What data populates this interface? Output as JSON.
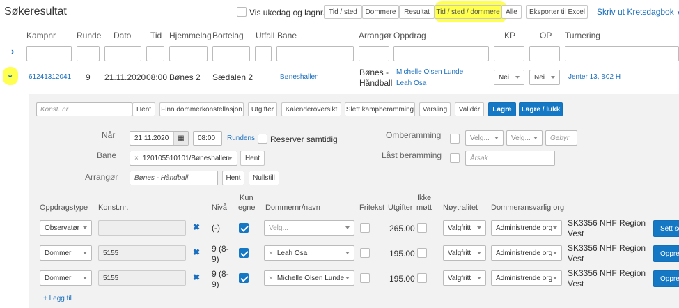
{
  "page_title": "Søkeresultat",
  "show_weekday_label": "Vis ukedag og lagnr.",
  "view_tabs": [
    "Tid / sted",
    "Dommere",
    "Resultat",
    "Tid / sted / dommere",
    "Alle"
  ],
  "export_label": "Eksporter til Excel",
  "print_label": "Skriv ut Kretsdagbok",
  "columns": [
    "Kampnr",
    "Runde",
    "Dato",
    "Tid",
    "Hjemmelag",
    "Bortelag",
    "Utfall",
    "Bane",
    "Arrangør",
    "Oppdrag",
    "KP",
    "OP",
    "Turnering"
  ],
  "match": {
    "kampnr": "61241312041",
    "runde": "9",
    "dato": "21.11.2020",
    "tid": "08:00",
    "hjemmelag": "Bønes 2",
    "bortelag": "Sædalen 2",
    "bane": "Bøneshallen",
    "arrangor_line1": "Bønes -",
    "arrangor_line2": "Håndball",
    "oppdrag1": "Michelle Olsen Lunde",
    "oppdrag2": "Leah Osa",
    "kp": "Nei",
    "op": "Nei",
    "turnering": "Jenter 13, B02 H"
  },
  "toolbar": {
    "konst_placeholder": "Konst. nr",
    "hent": "Hent",
    "finn": "Finn dommerkonstellasjon",
    "utgifter": "Utgifter",
    "kalender": "Kalenderoversikt",
    "slett": "Slett kampberamming",
    "varsling": "Varsling",
    "valider": "Validér",
    "lagre": "Lagre",
    "lagre_lukk": "Lagre / lukk"
  },
  "form": {
    "naar_label": "Når",
    "date": "21.11.2020",
    "time": "08:00",
    "rundens": "Rundens",
    "reserver": "Reserver samtidig",
    "bane_label": "Bane",
    "bane_value": "120105510101/Bøneshallen",
    "hent": "Hent",
    "arrangor_label": "Arrangør",
    "arrangor_value": "Bønes - Håndball",
    "nullstill": "Nullstill",
    "omberamming_label": "Omberamming",
    "velg1": "Velg...",
    "velg2": "Velg...",
    "gebyr": "Gebyr",
    "last_label": "Låst beramming",
    "arsak": "Årsak"
  },
  "assign_headers": {
    "type": "Oppdragstype",
    "konst": "Konst.nr.",
    "niva": "Nivå",
    "kun1": "Kun",
    "kun2": "egne",
    "dommer": "Dommernr/navn",
    "fritekst": "Fritekst",
    "utgifter": "Utgifter",
    "ikke1": "Ikke",
    "ikke2": "møtt",
    "noytralitet": "Nøytralitet",
    "ansvarlig": "Dommeransvarlig org"
  },
  "assignments": [
    {
      "type": "Observatør",
      "konst": "",
      "niva": "(-)",
      "niva2": "",
      "dommer": "Velg...",
      "utgifter": "265.00",
      "noytralitet": "Valgfritt",
      "ansvarlig": "Administrende org",
      "org1": "SK3356 NHF Region",
      "org2": "Vest",
      "action": "Sett se"
    },
    {
      "type": "Dommer",
      "konst": "5155",
      "niva": "9 (8-",
      "niva2": "9)",
      "dommer": "Leah Osa",
      "utgifter": "195.00",
      "noytralitet": "Valgfritt",
      "ansvarlig": "Administrende org",
      "org1": "SK3356 NHF Region",
      "org2": "Vest",
      "action": "Oppre"
    },
    {
      "type": "Dommer",
      "konst": "5155",
      "niva": "9 (8-",
      "niva2": "9)",
      "dommer": "Michelle Olsen Lunde",
      "utgifter": "195.00",
      "noytralitet": "Valgfritt",
      "ansvarlig": "Administrende org",
      "org1": "SK3356 NHF Region",
      "org2": "Vest",
      "action": "Oppre"
    }
  ],
  "legg_til": "Legg til",
  "colors": {
    "accent": "#1478c4",
    "highlight": "#ffff3c"
  }
}
